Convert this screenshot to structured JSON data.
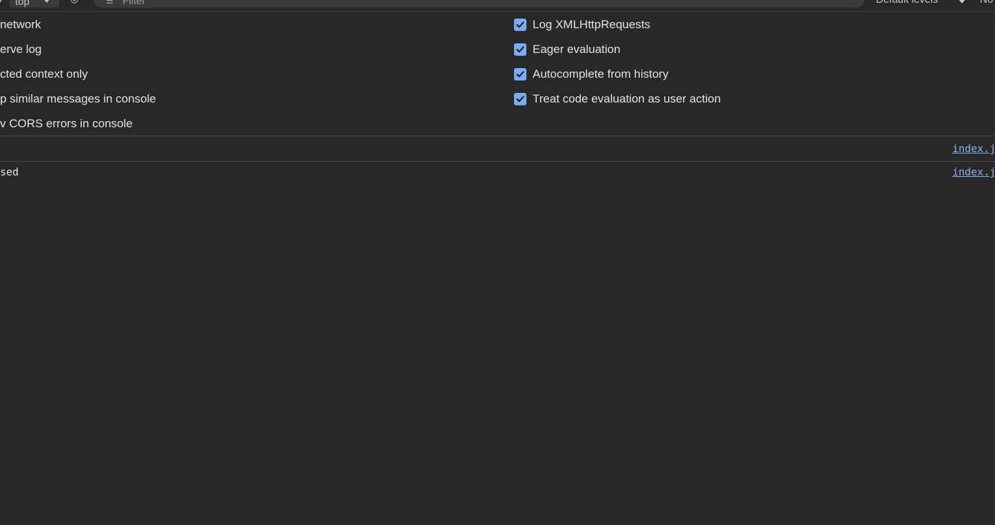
{
  "toolbar": {
    "context_label": "top",
    "filter_placeholder": "Filter",
    "levels_label": "Default levels",
    "issues_label": "No"
  },
  "settings": {
    "left": [
      {
        "label": "network"
      },
      {
        "label": "erve log"
      },
      {
        "label": "cted context only"
      },
      {
        "label": "p similar messages in console"
      },
      {
        "label": "v CORS errors in console"
      }
    ],
    "right": [
      {
        "label": "Log XMLHttpRequests",
        "checked": true
      },
      {
        "label": "Eager evaluation",
        "checked": true
      },
      {
        "label": "Autocomplete from history",
        "checked": true
      },
      {
        "label": "Treat code evaluation as user action",
        "checked": true
      }
    ]
  },
  "console": {
    "rows": [
      {
        "message": "",
        "source": "index.js"
      },
      {
        "message": "sed",
        "source": "index.js"
      }
    ]
  },
  "colors": {
    "background": "#282828",
    "checkbox": "#7cacf8",
    "link": "#8ab4f8"
  }
}
